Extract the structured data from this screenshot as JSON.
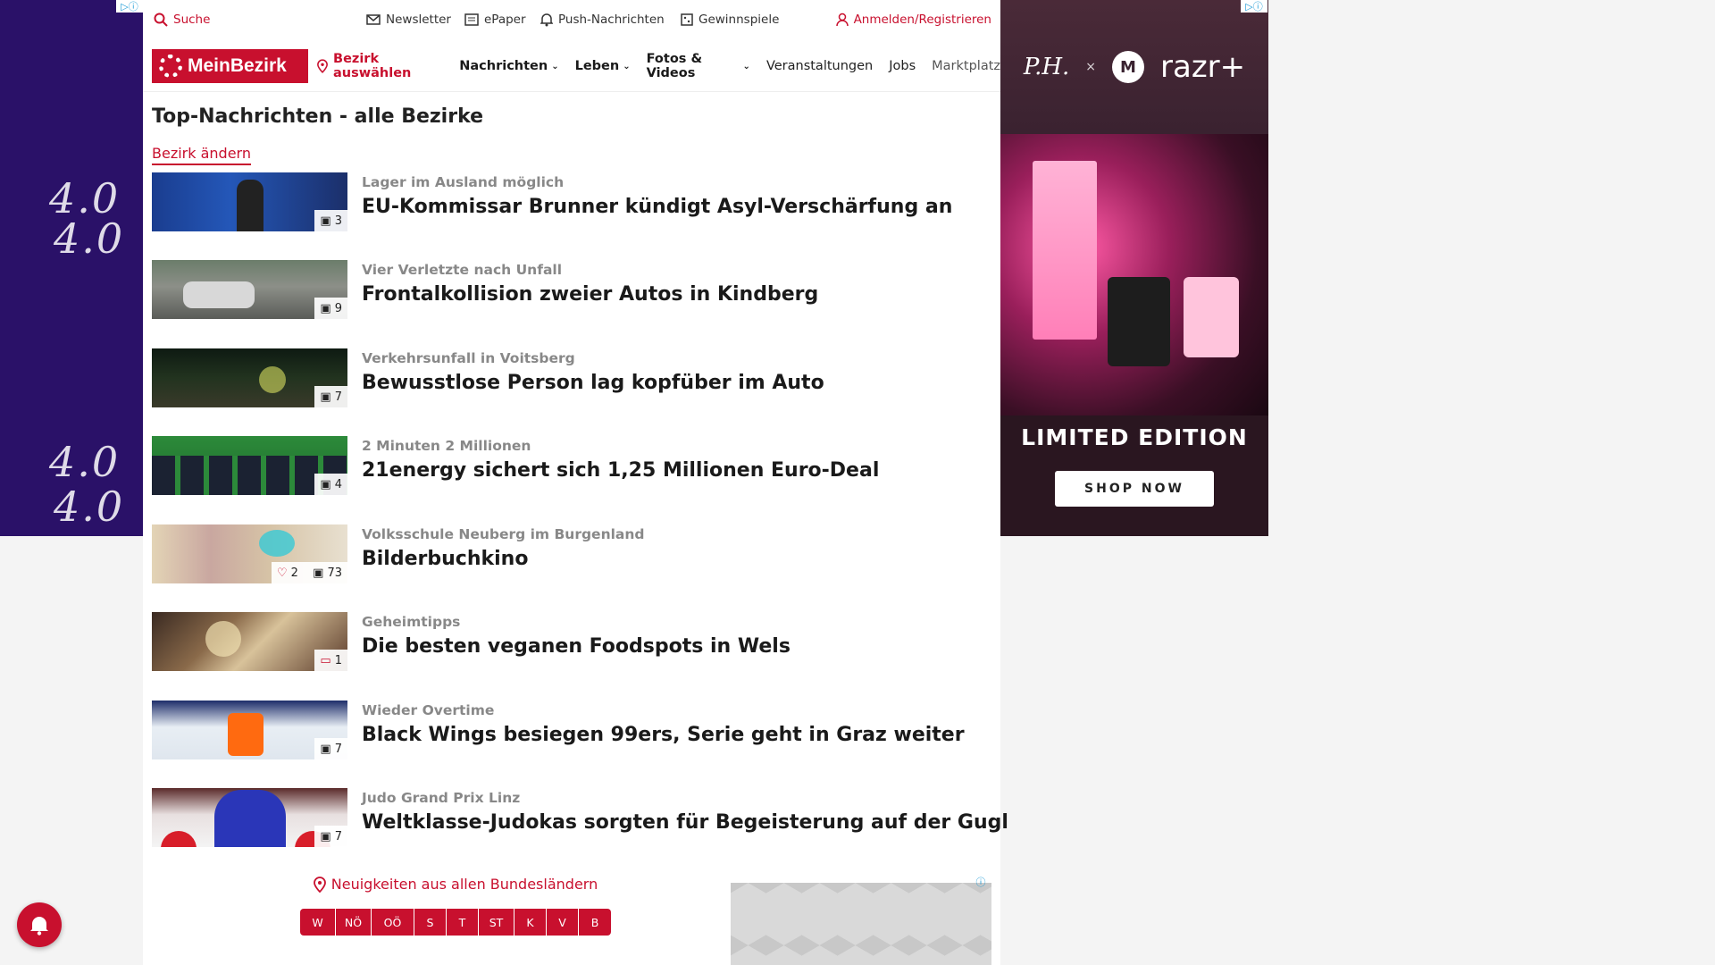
{
  "topbar": {
    "search": "Suche",
    "newsletter": "Newsletter",
    "epaper": "ePaper",
    "push": "Push-Nachrichten",
    "gewinnspiele": "Gewinnspiele",
    "login": "Anmelden/Registrieren"
  },
  "navbar": {
    "logo": "MeinBezirk",
    "bezirk": "Bezirk auswählen",
    "nachrichten": "Nachrichten",
    "leben": "Leben",
    "fotos": "Fotos & Videos",
    "veranstaltungen": "Veranstaltungen",
    "jobs": "Jobs",
    "marktplatz": "Marktplatz"
  },
  "section": {
    "heading": "Top-Nachrichten - alle Bezirke",
    "change": "Bezirk ändern"
  },
  "articles": [
    {
      "kicker": "Lager im Ausland möglich",
      "title": "EU-Kommissar Brunner kündigt Asyl-Verschärfung an",
      "images": "3"
    },
    {
      "kicker": "Vier Verletzte nach Unfall",
      "title": "Frontalkollision zweier Autos in Kindberg",
      "images": "9"
    },
    {
      "kicker": "Verkehrsunfall in Voitsberg",
      "title": "Bewusstlose Person lag kopfüber im Auto",
      "images": "7"
    },
    {
      "kicker": "2 Minuten 2 Millionen",
      "title": "21energy sichert sich 1,25 Millionen Euro-Deal",
      "images": "4"
    },
    {
      "kicker": "Volksschule Neuberg im Burgenland",
      "title": "Bilderbuchkino",
      "likes": "2",
      "images": "73"
    },
    {
      "kicker": "Geheimtipps",
      "title": "Die besten veganen Foodspots in Wels",
      "comments": "1"
    },
    {
      "kicker": "Wieder Overtime",
      "title": "Black Wings besiegen 99ers, Serie geht in Graz weiter",
      "images": "7"
    },
    {
      "kicker": "Judo Grand Prix Linz",
      "title": "Weltklasse-Judokas sorgten für Begeisterung auf der Gugl",
      "images": "7"
    }
  ],
  "regions": {
    "label": "Neuigkeiten aus allen Bundesländern",
    "buttons": [
      "W",
      "NÖ",
      "OÖ",
      "S",
      "T",
      "ST",
      "K",
      "V",
      "B"
    ]
  },
  "ads": {
    "right_edition": "LIMITED EDITION",
    "right_cta": "SHOP NOW",
    "right_brand": "razr+",
    "left_text": "4.0"
  },
  "colors": {
    "accent": "#c8102e",
    "skin": "#2a1168"
  }
}
